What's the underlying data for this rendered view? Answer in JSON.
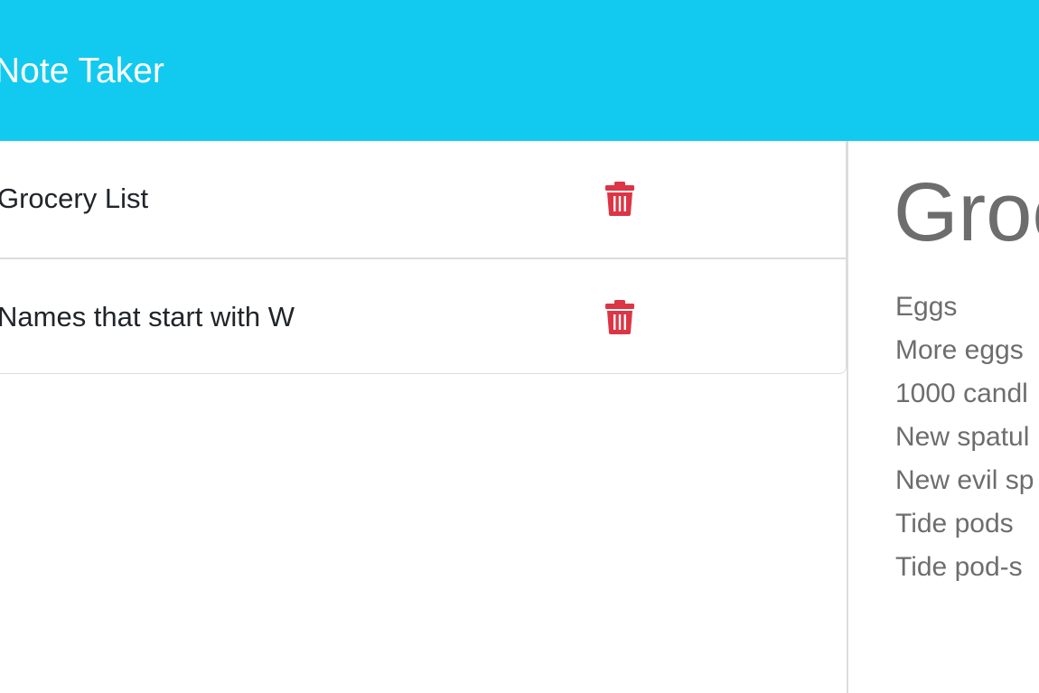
{
  "app": {
    "title": "Note Taker",
    "accent_color": "#12caef",
    "delete_color": "#dc3545"
  },
  "notes": [
    {
      "title": "Grocery List",
      "delete_icon": "trash-icon"
    },
    {
      "title": "Names that start with W",
      "delete_icon": "trash-icon"
    }
  ],
  "active_note": {
    "title": "Groc",
    "text_lines": [
      "Eggs",
      "More eggs",
      "1000 candl",
      "New spatul",
      "New evil sp",
      "Tide pods",
      "Tide pod-s"
    ]
  }
}
